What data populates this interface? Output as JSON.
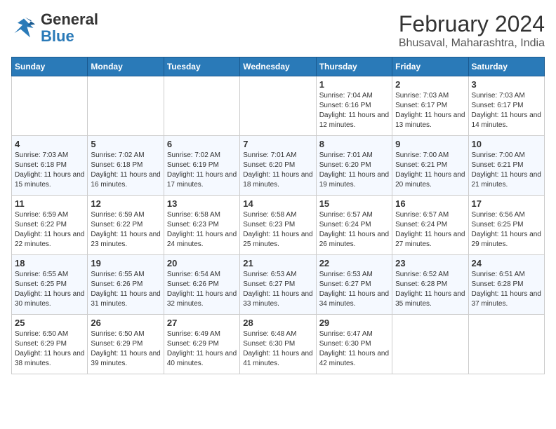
{
  "header": {
    "logo_general": "General",
    "logo_blue": "Blue",
    "title": "February 2024",
    "subtitle": "Bhusaval, Maharashtra, India"
  },
  "weekdays": [
    "Sunday",
    "Monday",
    "Tuesday",
    "Wednesday",
    "Thursday",
    "Friday",
    "Saturday"
  ],
  "weeks": [
    [
      {
        "day": "",
        "sunrise": "",
        "sunset": "",
        "daylight": ""
      },
      {
        "day": "",
        "sunrise": "",
        "sunset": "",
        "daylight": ""
      },
      {
        "day": "",
        "sunrise": "",
        "sunset": "",
        "daylight": ""
      },
      {
        "day": "",
        "sunrise": "",
        "sunset": "",
        "daylight": ""
      },
      {
        "day": "1",
        "sunrise": "Sunrise: 7:04 AM",
        "sunset": "Sunset: 6:16 PM",
        "daylight": "Daylight: 11 hours and 12 minutes."
      },
      {
        "day": "2",
        "sunrise": "Sunrise: 7:03 AM",
        "sunset": "Sunset: 6:17 PM",
        "daylight": "Daylight: 11 hours and 13 minutes."
      },
      {
        "day": "3",
        "sunrise": "Sunrise: 7:03 AM",
        "sunset": "Sunset: 6:17 PM",
        "daylight": "Daylight: 11 hours and 14 minutes."
      }
    ],
    [
      {
        "day": "4",
        "sunrise": "Sunrise: 7:03 AM",
        "sunset": "Sunset: 6:18 PM",
        "daylight": "Daylight: 11 hours and 15 minutes."
      },
      {
        "day": "5",
        "sunrise": "Sunrise: 7:02 AM",
        "sunset": "Sunset: 6:18 PM",
        "daylight": "Daylight: 11 hours and 16 minutes."
      },
      {
        "day": "6",
        "sunrise": "Sunrise: 7:02 AM",
        "sunset": "Sunset: 6:19 PM",
        "daylight": "Daylight: 11 hours and 17 minutes."
      },
      {
        "day": "7",
        "sunrise": "Sunrise: 7:01 AM",
        "sunset": "Sunset: 6:20 PM",
        "daylight": "Daylight: 11 hours and 18 minutes."
      },
      {
        "day": "8",
        "sunrise": "Sunrise: 7:01 AM",
        "sunset": "Sunset: 6:20 PM",
        "daylight": "Daylight: 11 hours and 19 minutes."
      },
      {
        "day": "9",
        "sunrise": "Sunrise: 7:00 AM",
        "sunset": "Sunset: 6:21 PM",
        "daylight": "Daylight: 11 hours and 20 minutes."
      },
      {
        "day": "10",
        "sunrise": "Sunrise: 7:00 AM",
        "sunset": "Sunset: 6:21 PM",
        "daylight": "Daylight: 11 hours and 21 minutes."
      }
    ],
    [
      {
        "day": "11",
        "sunrise": "Sunrise: 6:59 AM",
        "sunset": "Sunset: 6:22 PM",
        "daylight": "Daylight: 11 hours and 22 minutes."
      },
      {
        "day": "12",
        "sunrise": "Sunrise: 6:59 AM",
        "sunset": "Sunset: 6:22 PM",
        "daylight": "Daylight: 11 hours and 23 minutes."
      },
      {
        "day": "13",
        "sunrise": "Sunrise: 6:58 AM",
        "sunset": "Sunset: 6:23 PM",
        "daylight": "Daylight: 11 hours and 24 minutes."
      },
      {
        "day": "14",
        "sunrise": "Sunrise: 6:58 AM",
        "sunset": "Sunset: 6:23 PM",
        "daylight": "Daylight: 11 hours and 25 minutes."
      },
      {
        "day": "15",
        "sunrise": "Sunrise: 6:57 AM",
        "sunset": "Sunset: 6:24 PM",
        "daylight": "Daylight: 11 hours and 26 minutes."
      },
      {
        "day": "16",
        "sunrise": "Sunrise: 6:57 AM",
        "sunset": "Sunset: 6:24 PM",
        "daylight": "Daylight: 11 hours and 27 minutes."
      },
      {
        "day": "17",
        "sunrise": "Sunrise: 6:56 AM",
        "sunset": "Sunset: 6:25 PM",
        "daylight": "Daylight: 11 hours and 29 minutes."
      }
    ],
    [
      {
        "day": "18",
        "sunrise": "Sunrise: 6:55 AM",
        "sunset": "Sunset: 6:25 PM",
        "daylight": "Daylight: 11 hours and 30 minutes."
      },
      {
        "day": "19",
        "sunrise": "Sunrise: 6:55 AM",
        "sunset": "Sunset: 6:26 PM",
        "daylight": "Daylight: 11 hours and 31 minutes."
      },
      {
        "day": "20",
        "sunrise": "Sunrise: 6:54 AM",
        "sunset": "Sunset: 6:26 PM",
        "daylight": "Daylight: 11 hours and 32 minutes."
      },
      {
        "day": "21",
        "sunrise": "Sunrise: 6:53 AM",
        "sunset": "Sunset: 6:27 PM",
        "daylight": "Daylight: 11 hours and 33 minutes."
      },
      {
        "day": "22",
        "sunrise": "Sunrise: 6:53 AM",
        "sunset": "Sunset: 6:27 PM",
        "daylight": "Daylight: 11 hours and 34 minutes."
      },
      {
        "day": "23",
        "sunrise": "Sunrise: 6:52 AM",
        "sunset": "Sunset: 6:28 PM",
        "daylight": "Daylight: 11 hours and 35 minutes."
      },
      {
        "day": "24",
        "sunrise": "Sunrise: 6:51 AM",
        "sunset": "Sunset: 6:28 PM",
        "daylight": "Daylight: 11 hours and 37 minutes."
      }
    ],
    [
      {
        "day": "25",
        "sunrise": "Sunrise: 6:50 AM",
        "sunset": "Sunset: 6:29 PM",
        "daylight": "Daylight: 11 hours and 38 minutes."
      },
      {
        "day": "26",
        "sunrise": "Sunrise: 6:50 AM",
        "sunset": "Sunset: 6:29 PM",
        "daylight": "Daylight: 11 hours and 39 minutes."
      },
      {
        "day": "27",
        "sunrise": "Sunrise: 6:49 AM",
        "sunset": "Sunset: 6:29 PM",
        "daylight": "Daylight: 11 hours and 40 minutes."
      },
      {
        "day": "28",
        "sunrise": "Sunrise: 6:48 AM",
        "sunset": "Sunset: 6:30 PM",
        "daylight": "Daylight: 11 hours and 41 minutes."
      },
      {
        "day": "29",
        "sunrise": "Sunrise: 6:47 AM",
        "sunset": "Sunset: 6:30 PM",
        "daylight": "Daylight: 11 hours and 42 minutes."
      },
      {
        "day": "",
        "sunrise": "",
        "sunset": "",
        "daylight": ""
      },
      {
        "day": "",
        "sunrise": "",
        "sunset": "",
        "daylight": ""
      }
    ]
  ]
}
